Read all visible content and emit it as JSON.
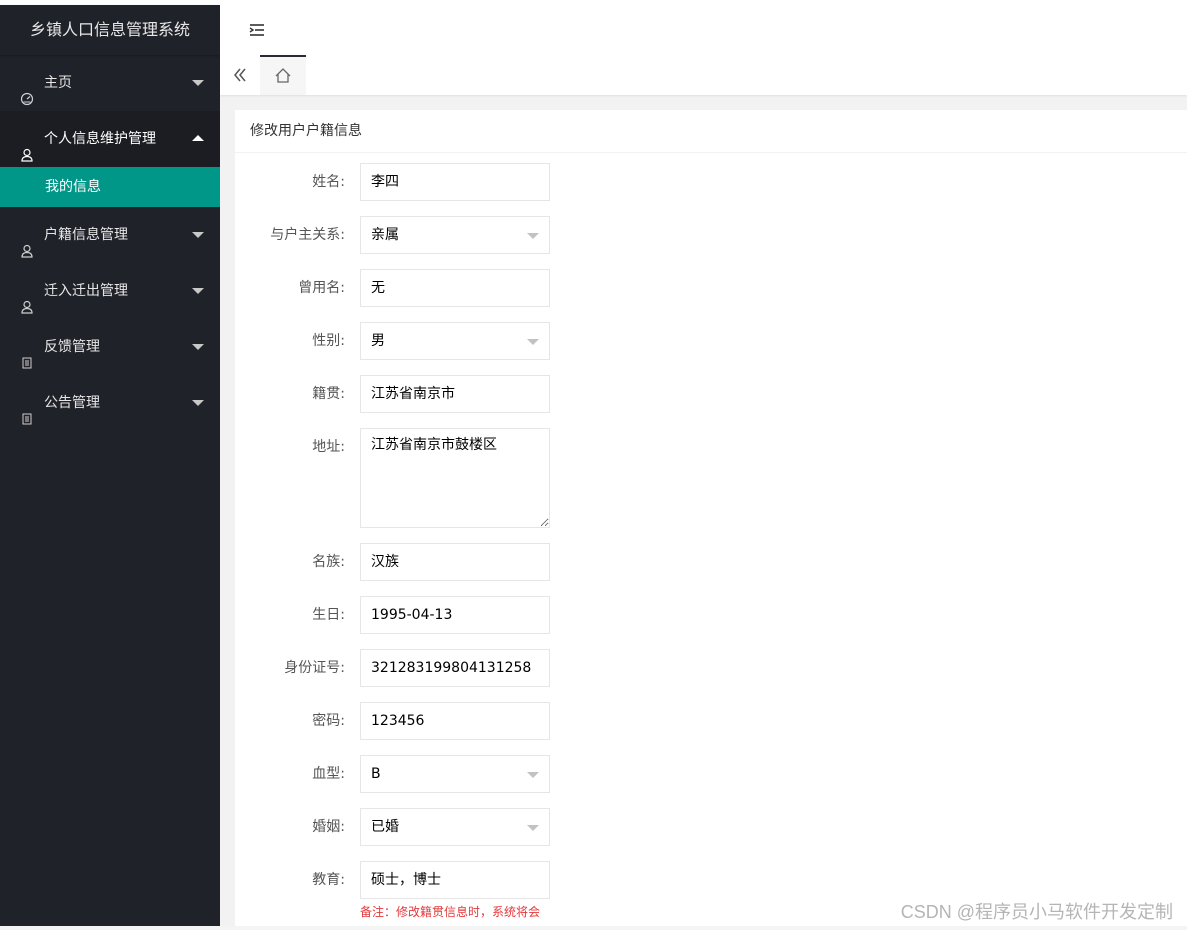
{
  "app": {
    "title": "乡镇人口信息管理系统"
  },
  "sidebar": {
    "items": [
      {
        "label": "主页",
        "icon": "dashboard-icon",
        "expanded": false
      },
      {
        "label": "个人信息维护管理",
        "icon": "user-icon",
        "expanded": true,
        "children": [
          {
            "label": "我的信息",
            "active": true
          }
        ]
      },
      {
        "label": "户籍信息管理",
        "icon": "user-icon",
        "expanded": false
      },
      {
        "label": "迁入迁出管理",
        "icon": "user-icon",
        "expanded": false
      },
      {
        "label": "反馈管理",
        "icon": "document-icon",
        "expanded": false
      },
      {
        "label": "公告管理",
        "icon": "document-icon",
        "expanded": false
      }
    ]
  },
  "card": {
    "title": "修改用户户籍信息"
  },
  "form": {
    "name": {
      "label": "姓名:",
      "value": "李四"
    },
    "relation": {
      "label": "与户主关系:",
      "value": "亲属"
    },
    "alias": {
      "label": "曾用名:",
      "value": "无"
    },
    "gender": {
      "label": "性别:",
      "value": "男"
    },
    "origin": {
      "label": "籍贯:",
      "value": "江苏省南京市"
    },
    "address": {
      "label": "地址:",
      "value": "江苏省南京市鼓楼区"
    },
    "ethnicity": {
      "label": "名族:",
      "value": "汉族"
    },
    "birthday": {
      "label": "生日:",
      "value": "1995-04-13"
    },
    "idcard": {
      "label": "身份证号:",
      "value": "321283199804131258"
    },
    "password": {
      "label": "密码:",
      "value": "123456"
    },
    "blood": {
      "label": "血型:",
      "value": "B"
    },
    "marriage": {
      "label": "婚姻:",
      "value": "已婚"
    },
    "education": {
      "label": "教育:",
      "value": "硕士，博士"
    },
    "note": "备注：修改籍贯信息时，系统将会"
  },
  "watermark": "CSDN @程序员小马软件开发定制",
  "colors": {
    "sidebar_bg": "#20222a",
    "active": "#009688",
    "note": "#e4393c"
  }
}
